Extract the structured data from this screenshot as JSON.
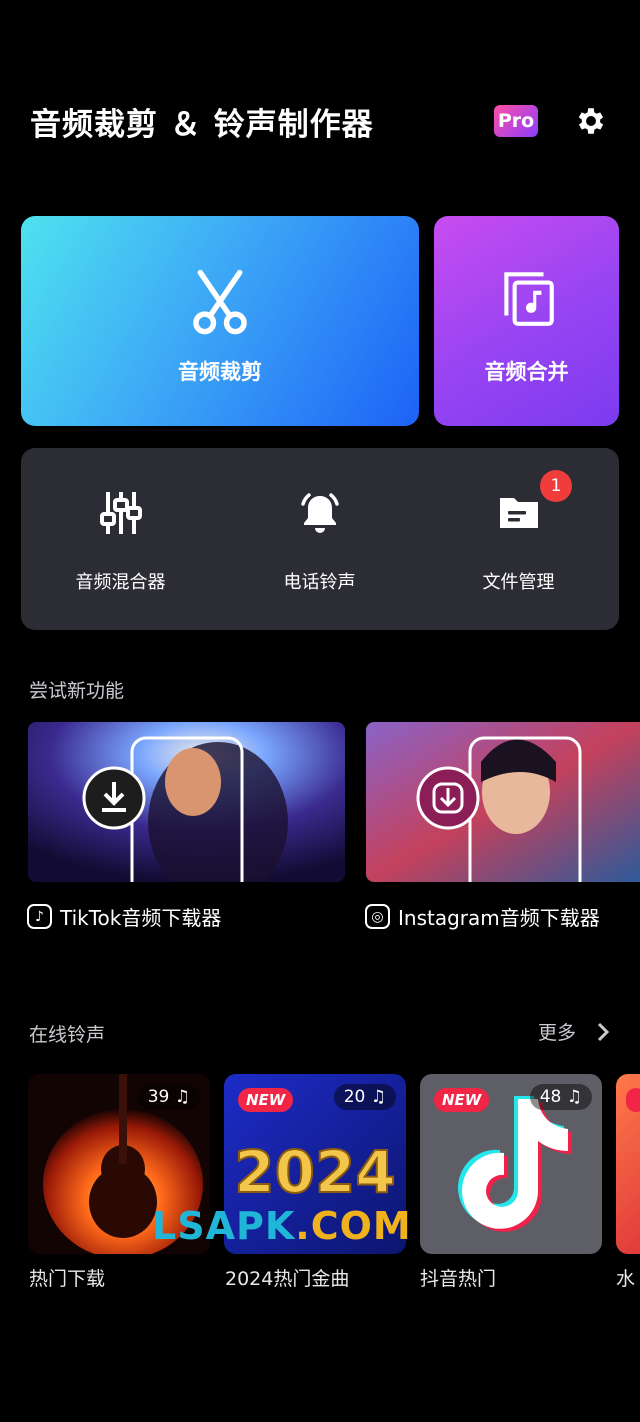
{
  "header": {
    "title": "音频裁剪 ＆ 铃声制作器",
    "pro_label": "Pro"
  },
  "main_cards": {
    "cut_label": "音频裁剪",
    "merge_label": "音频合并"
  },
  "tools": {
    "mixer_label": "音频混合器",
    "ringtone_label": "电话铃声",
    "files_label": "文件管理",
    "files_badge": "1"
  },
  "features": {
    "section_title": "尝试新功能",
    "tiktok_label": "TikTok音频下载器",
    "instagram_label": "Instagram音频下载器"
  },
  "ringtones": {
    "section_title": "在线铃声",
    "more_label": "更多",
    "items": [
      {
        "label": "热门下载",
        "count": "39",
        "is_new": false
      },
      {
        "label": "2024热门金曲",
        "count": "20",
        "is_new": true,
        "art_text": "2024"
      },
      {
        "label": "抖音热门",
        "count": "48",
        "is_new": true
      },
      {
        "label": "水"
      }
    ],
    "new_tag": "NEW"
  },
  "watermark": {
    "part1": "LSAPK",
    "part2": ".COM"
  },
  "colors": {
    "cut_gradient_end": "#1d62f6",
    "merge_gradient_start": "#c84cf0",
    "panel_bg": "#2c2c34",
    "badge_red": "#f13c3c"
  }
}
